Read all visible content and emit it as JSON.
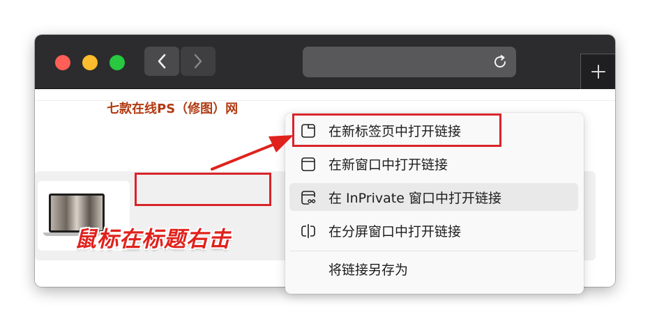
{
  "browser": {
    "icons": {
      "back": "chevron-left-icon",
      "forward": "chevron-right-icon",
      "reload": "reload-icon",
      "new_tab": "plus-icon"
    }
  },
  "page": {
    "article_title": "七款在线PS（修图）网",
    "annotation": "鼠标在标题右击"
  },
  "context_menu": {
    "items": [
      {
        "label": "在新标签页中打开链接",
        "icon": "new-tab-icon"
      },
      {
        "label": "在新窗口中打开链接",
        "icon": "new-window-icon"
      },
      {
        "label": "在 InPrivate 窗口中打开链接",
        "icon": "inprivate-window-icon"
      },
      {
        "label": "在分屏窗口中打开链接",
        "icon": "split-screen-icon"
      },
      {
        "label": "将链接另存为",
        "icon": ""
      }
    ]
  },
  "colors": {
    "highlight_red": "#d9232a",
    "title_color": "#b13a12",
    "titlebar": "#2c2c2e"
  }
}
